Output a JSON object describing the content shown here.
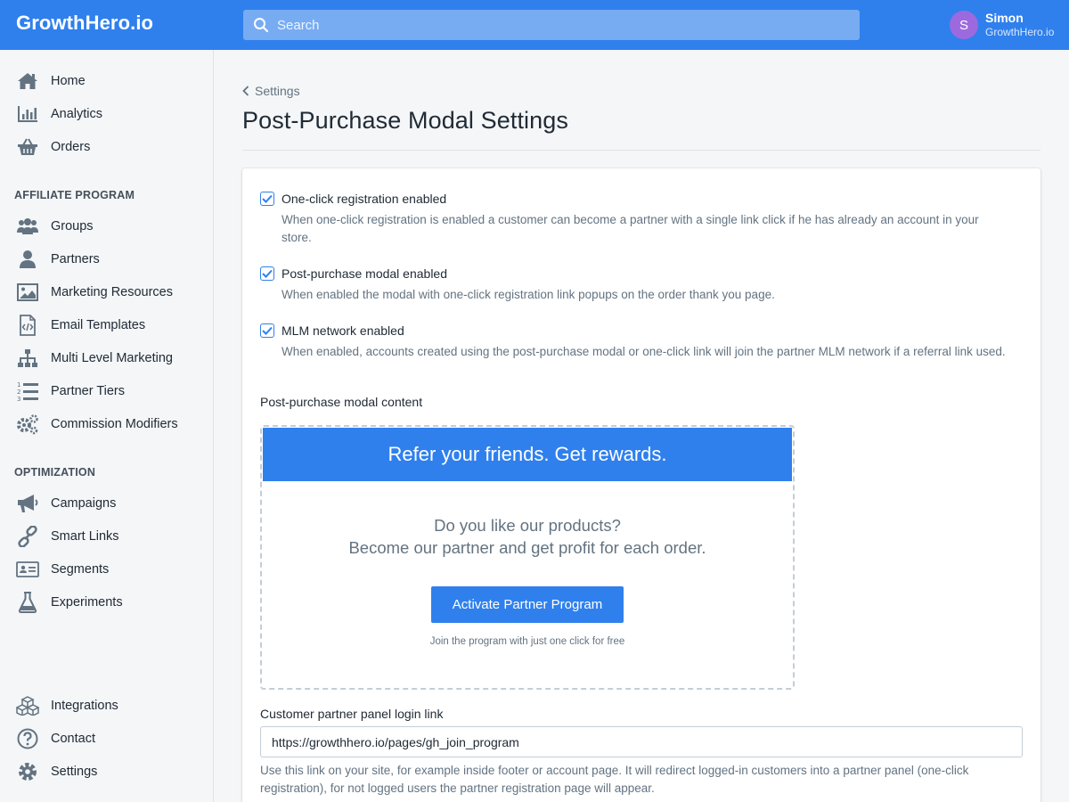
{
  "app": {
    "logo": "GrowthHero.io",
    "search_placeholder": "Search",
    "user": {
      "initial": "S",
      "name": "Simon",
      "org": "GrowthHero.io"
    }
  },
  "sidebar": {
    "main_items": [
      {
        "label": "Home",
        "icon": "home-icon"
      },
      {
        "label": "Analytics",
        "icon": "bar-chart-icon"
      },
      {
        "label": "Orders",
        "icon": "basket-icon"
      }
    ],
    "affiliate_title": "AFFILIATE PROGRAM",
    "affiliate_items": [
      {
        "label": "Groups",
        "icon": "users-icon"
      },
      {
        "label": "Partners",
        "icon": "user-icon"
      },
      {
        "label": "Marketing Resources",
        "icon": "image-icon"
      },
      {
        "label": "Email Templates",
        "icon": "code-file-icon"
      },
      {
        "label": "Multi Level Marketing",
        "icon": "sitemap-icon"
      },
      {
        "label": "Partner Tiers",
        "icon": "numbered-list-icon"
      },
      {
        "label": "Commission Modifiers",
        "icon": "gears-icon"
      }
    ],
    "optimization_title": "OPTIMIZATION",
    "optimization_items": [
      {
        "label": "Campaigns",
        "icon": "megaphone-icon"
      },
      {
        "label": "Smart Links",
        "icon": "link-icon"
      },
      {
        "label": "Segments",
        "icon": "id-card-icon"
      },
      {
        "label": "Experiments",
        "icon": "flask-icon"
      }
    ],
    "bottom_items": [
      {
        "label": "Integrations",
        "icon": "cubes-icon"
      },
      {
        "label": "Contact",
        "icon": "question-icon"
      },
      {
        "label": "Settings",
        "icon": "gear-icon"
      }
    ]
  },
  "page": {
    "breadcrumb": "Settings",
    "title": "Post-Purchase Modal Settings",
    "options": [
      {
        "title": "One-click registration enabled",
        "checked": true,
        "description": "When one-click registration is enabled a customer can become a partner with a single link click if he has already an account in your store."
      },
      {
        "title": "Post-purchase modal enabled",
        "checked": true,
        "description": "When enabled the modal with one-click registration link popups on the order thank you page."
      },
      {
        "title": "MLM network enabled",
        "checked": true,
        "description": "When enabled, accounts created using the post-purchase modal or one-click link will join the partner MLM network if a referral link used."
      }
    ],
    "modal_content_label": "Post-purchase modal content",
    "modal_preview": {
      "header": "Refer your friends. Get rewards.",
      "line1": "Do you like our products?",
      "line2": "Become our partner and get profit for each order.",
      "button": "Activate Partner Program",
      "note": "Join the program with just one click for free"
    },
    "login_link": {
      "label": "Customer partner panel login link",
      "value": "https://growthhero.io/pages/gh_join_program",
      "help": "Use this link on your site, for example inside footer or account page. It will redirect logged-in customers into a partner panel (one-click registration), for not logged users the partner registration page will appear."
    }
  },
  "colors": {
    "primary": "#2f80ed",
    "avatar": "#9c6ade",
    "text": "#212b36",
    "muted": "#637381"
  }
}
